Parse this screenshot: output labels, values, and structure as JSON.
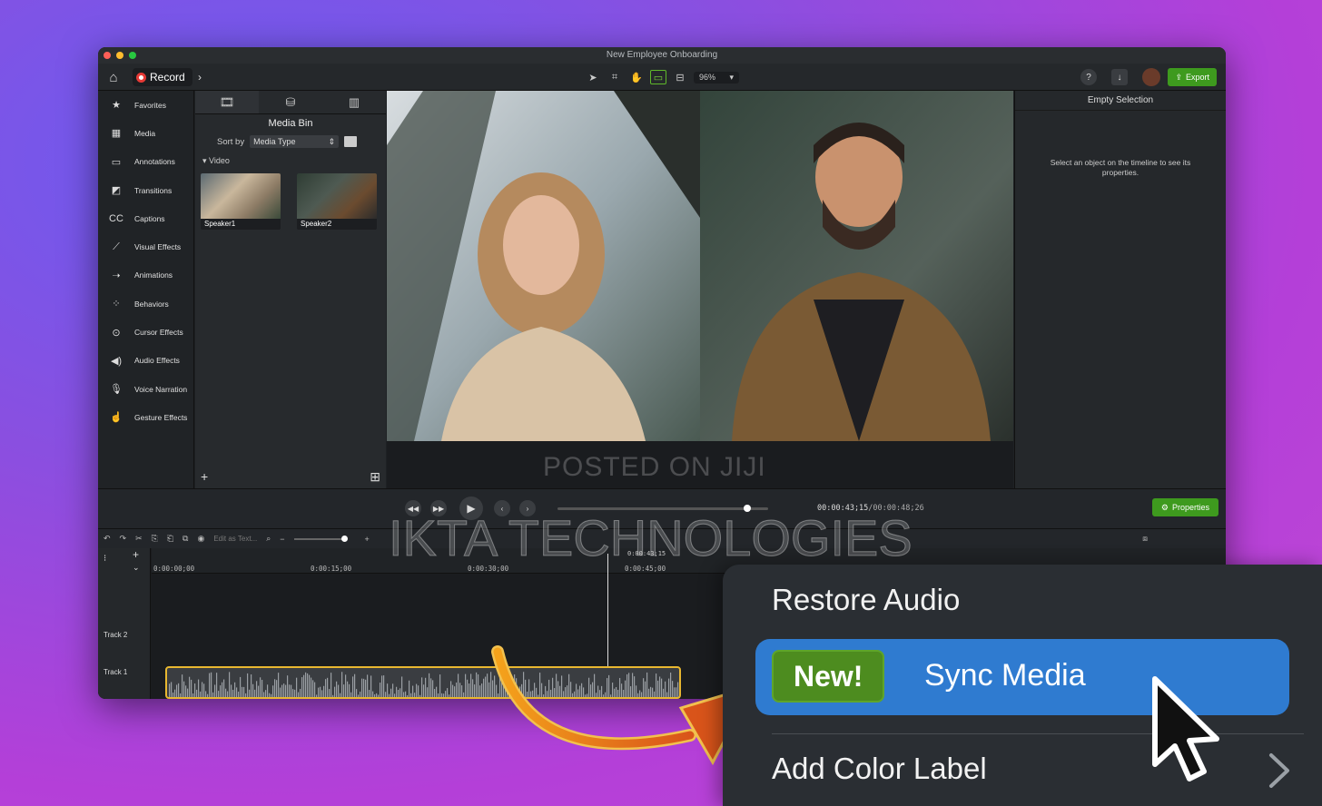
{
  "window": {
    "title": "New Employee Onboarding"
  },
  "toolbar": {
    "record_label": "Record",
    "zoom": "96%",
    "export_label": "Export",
    "help": "?"
  },
  "sidebar": {
    "items": [
      {
        "label": "Favorites",
        "icon": "★"
      },
      {
        "label": "Media",
        "icon": "▦"
      },
      {
        "label": "Annotations",
        "icon": "▭"
      },
      {
        "label": "Transitions",
        "icon": "◩"
      },
      {
        "label": "Captions",
        "icon": "CC"
      },
      {
        "label": "Visual Effects",
        "icon": "⟋"
      },
      {
        "label": "Animations",
        "icon": "➝"
      },
      {
        "label": "Behaviors",
        "icon": "⁘"
      },
      {
        "label": "Cursor Effects",
        "icon": "⊙"
      },
      {
        "label": "Audio Effects",
        "icon": "◀)"
      },
      {
        "label": "Voice Narration",
        "icon": "🎙"
      },
      {
        "label": "Gesture Effects",
        "icon": "☝"
      }
    ]
  },
  "media_bin": {
    "title": "Media Bin",
    "sort_label": "Sort by",
    "sort_value": "Media Type",
    "group_label": "Video",
    "clips": [
      {
        "name": "Speaker1"
      },
      {
        "name": "Speaker2"
      }
    ]
  },
  "properties": {
    "title": "Empty Selection",
    "message": "Select an object on the timeline to see its properties.",
    "button_label": "Properties"
  },
  "playback": {
    "current_time": "00:00:43;15",
    "total_time": "00:00:48;26",
    "progress": 0.9
  },
  "timeline": {
    "edit_as_text": "Edit as Text...",
    "playhead_time": "0:00:43;15",
    "ruler": [
      "0:00:00;00",
      "0:00:15;00",
      "0:00:30;00",
      "0:00:45;00"
    ],
    "tracks": [
      {
        "label": "Track 2"
      },
      {
        "label": "Track 1"
      }
    ]
  },
  "context_menu": {
    "restore_audio": "Restore Audio",
    "new_badge": "New!",
    "sync_media": "Sync Media",
    "add_color_label": "Add Color Label"
  },
  "watermarks": {
    "posted": "POSTED ON JIJI",
    "brand": "IKTA TECHNOLOGIES"
  },
  "colors": {
    "accent_green": "#3e9a1e",
    "highlight_blue": "#2f7bd0",
    "clip_border": "#e8b730"
  }
}
